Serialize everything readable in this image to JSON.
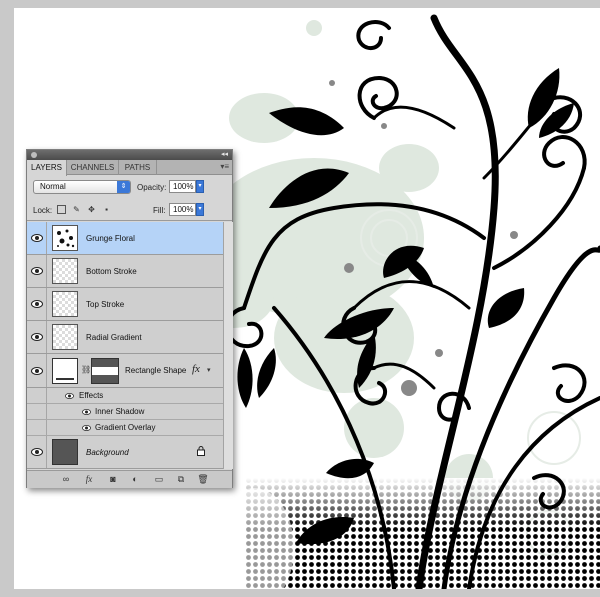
{
  "panel": {
    "tabs": [
      {
        "label": "LAYERS",
        "active": true
      },
      {
        "label": "CHANNELS",
        "active": false
      },
      {
        "label": "PATHS",
        "active": false
      }
    ],
    "blend_mode": "Normal",
    "opacity_label": "Opacity:",
    "opacity_value": "100%",
    "lock_label": "Lock:",
    "fill_label": "Fill:",
    "fill_value": "100%",
    "layers": [
      {
        "name": "Grunge Floral",
        "selected": true
      },
      {
        "name": "Bottom Stroke",
        "selected": false
      },
      {
        "name": "Top Stroke",
        "selected": false
      },
      {
        "name": "Radial Gradient",
        "selected": false
      },
      {
        "name": "Rectangle Shape",
        "selected": false,
        "fx": "fx"
      },
      {
        "name": "Background",
        "selected": false,
        "locked": true
      }
    ],
    "effects_label": "Effects",
    "effects": [
      "Inner Shadow",
      "Gradient Overlay"
    ],
    "bottom_icons": [
      "link-icon",
      "fx-icon",
      "mask-icon",
      "adjustment-icon",
      "group-folder-icon",
      "new-layer-icon",
      "trash-icon"
    ],
    "bottom_fx_label": "fx"
  },
  "colors": {
    "selection": "#b5d3f7",
    "panel_bg": "#d6d6d6",
    "accent_blue": "#3b78d8",
    "canvas_bg": "#ffffff",
    "artwork": "#000000",
    "grunge_tint": "#dfe8df"
  }
}
